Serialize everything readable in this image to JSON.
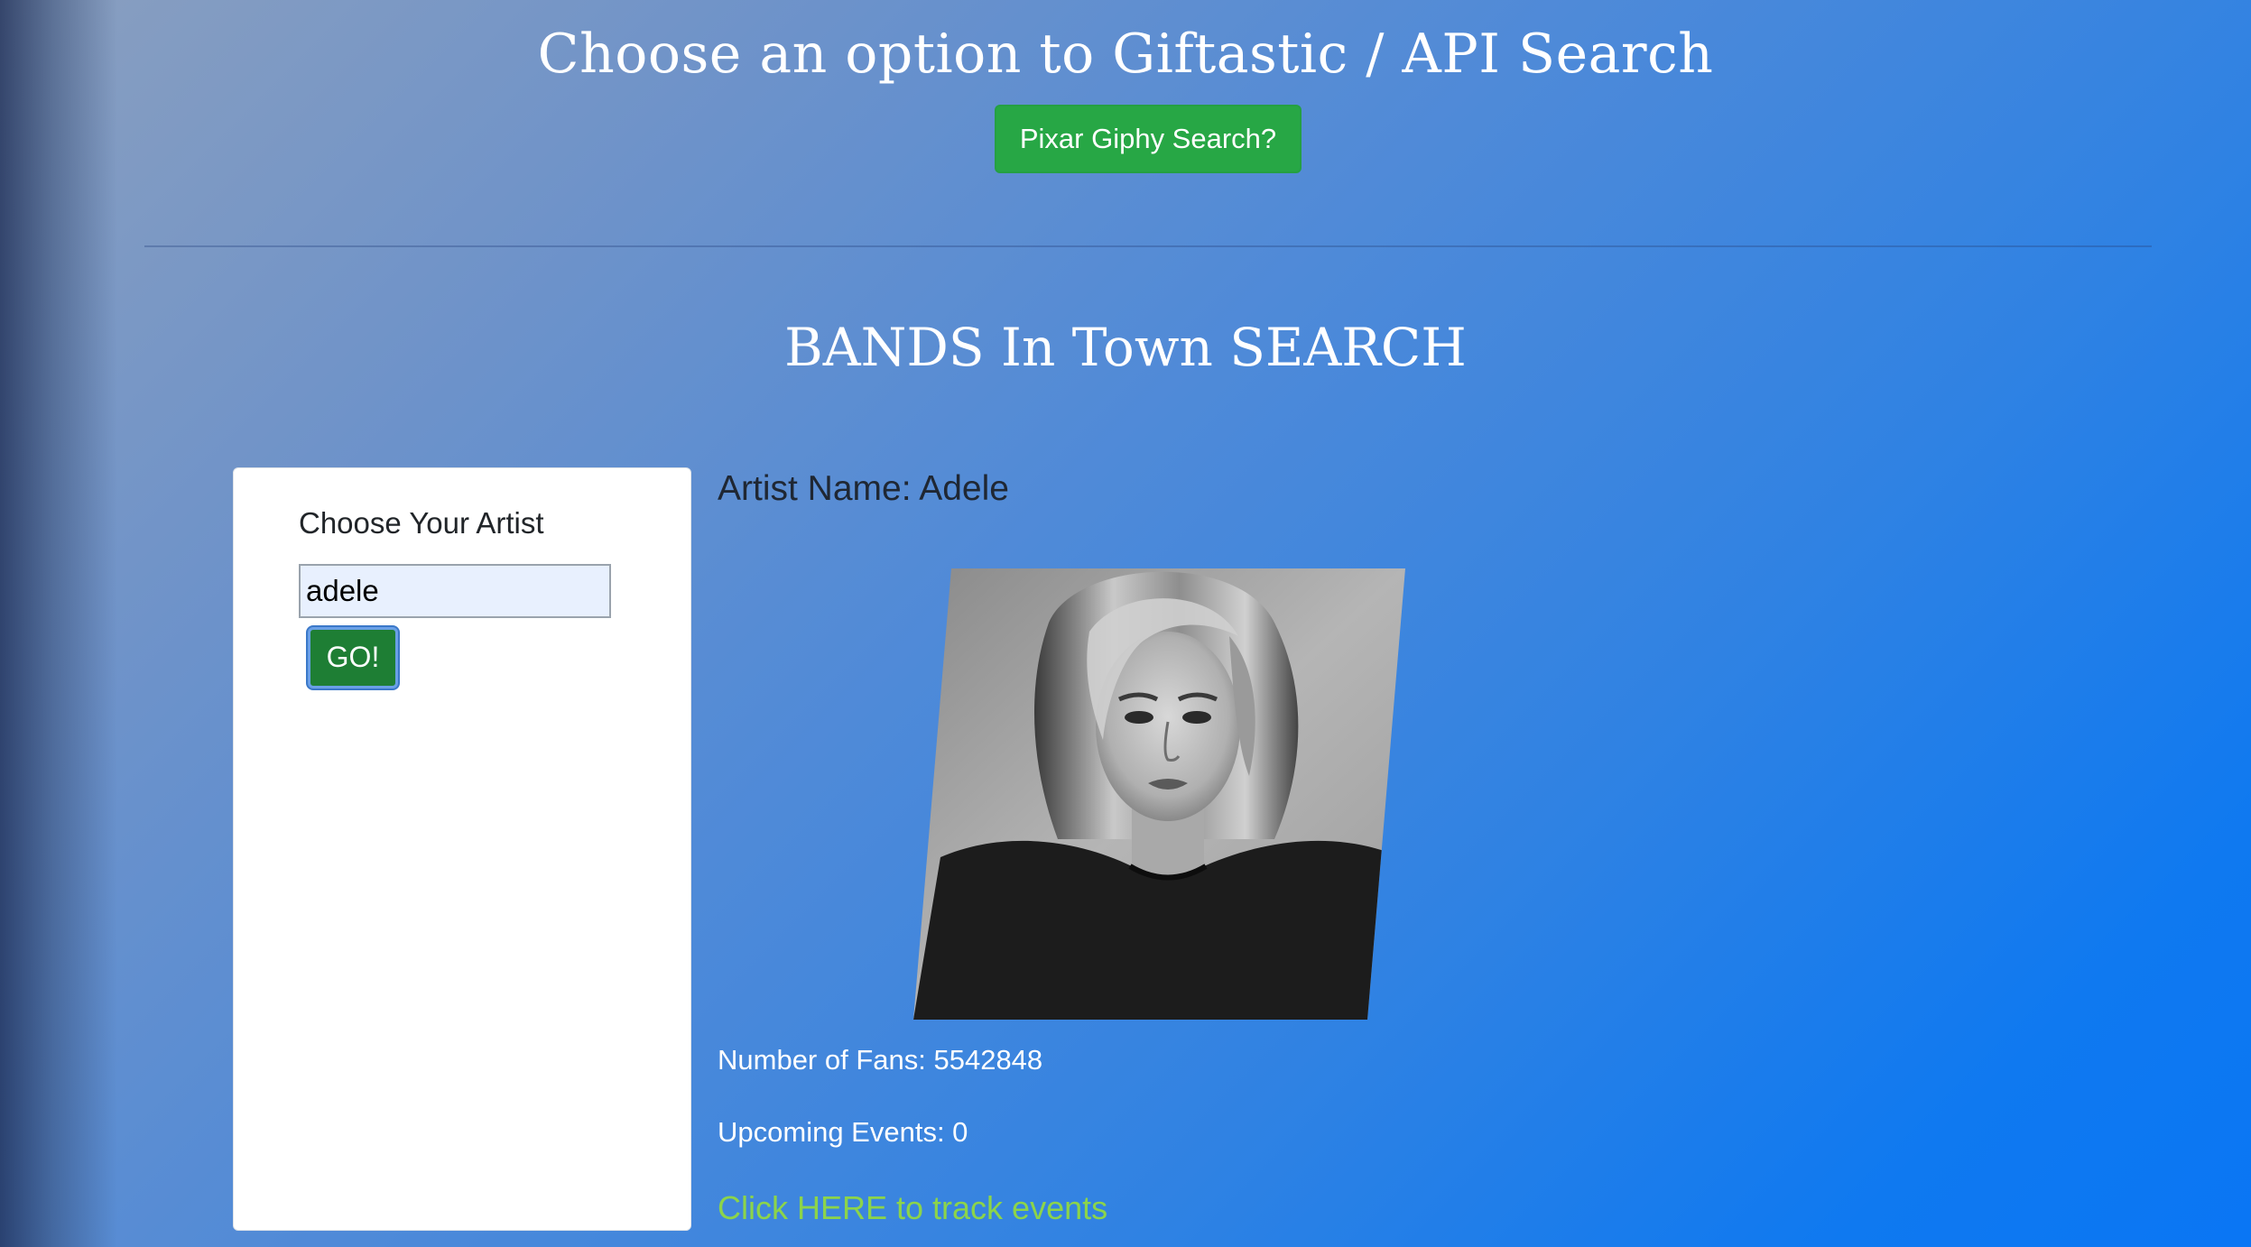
{
  "header": {
    "title": "Choose an option to Giftastic / API Search",
    "pixar_button_label": "Pixar Giphy Search?"
  },
  "section": {
    "title": "BANDS In Town SEARCH"
  },
  "search_panel": {
    "label": "Choose Your Artist",
    "input_value": "adele",
    "go_button_label": "GO!"
  },
  "result": {
    "artist_name": "Artist Name: Adele",
    "fans": "Number of Fans: 5542848",
    "upcoming_events": "Upcoming Events: 0",
    "track_link": "Click HERE to track events"
  },
  "colors": {
    "accent_green": "#27a745",
    "go_green": "#1e7e34",
    "link_green": "#8cd44a",
    "page_blue": "#0a76f4"
  }
}
